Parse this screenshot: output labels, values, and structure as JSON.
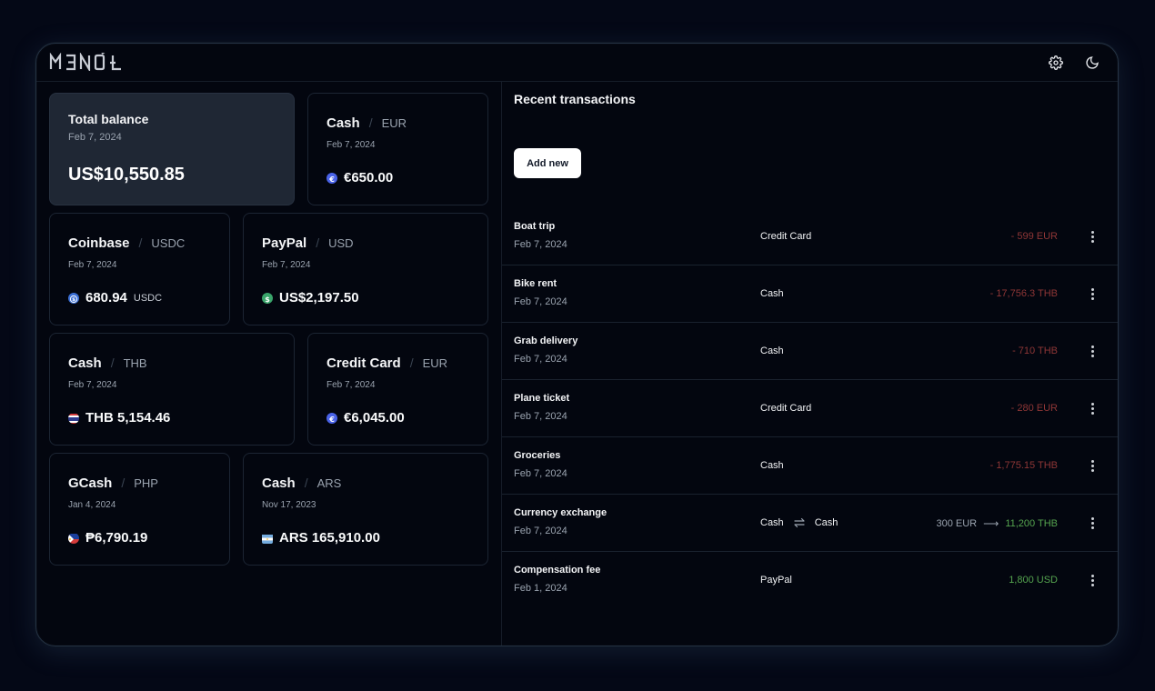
{
  "app": {
    "logo": "ᗰ ƎИ Ơ Ł"
  },
  "topbar": {
    "settings_icon": "gear-icon",
    "theme_icon": "moon-icon"
  },
  "total": {
    "title": "Total balance",
    "date": "Feb 7, 2024",
    "amount": "US$10,550.85"
  },
  "accounts": [
    {
      "name": "Cash",
      "currency": "EUR",
      "date": "Feb 7, 2024",
      "amount": "€650.00",
      "unit": "",
      "icon": "euro-coin-icon",
      "color": "#3f5fe0"
    },
    {
      "name": "Coinbase",
      "currency": "USDC",
      "date": "Feb 7, 2024",
      "amount": "680.94",
      "unit": "USDC",
      "icon": "usdc-coin-icon",
      "color": "#3b6fd4"
    },
    {
      "name": "PayPal",
      "currency": "USD",
      "date": "Feb 7, 2024",
      "amount": "US$2,197.50",
      "unit": "",
      "icon": "dollar-coin-icon",
      "color": "#3aa56b"
    },
    {
      "name": "Cash",
      "currency": "THB",
      "date": "Feb 7, 2024",
      "amount": "THB 5,154.46",
      "unit": "",
      "icon": "thailand-flag-icon",
      "color": "#2d3a8c"
    },
    {
      "name": "Credit Card",
      "currency": "EUR",
      "date": "Feb 7, 2024",
      "amount": "€6,045.00",
      "unit": "",
      "icon": "euro-coin-icon",
      "color": "#3f5fe0"
    },
    {
      "name": "GCash",
      "currency": "PHP",
      "date": "Jan 4, 2024",
      "amount": "₱6,790.19",
      "unit": "",
      "icon": "philippines-flag-icon",
      "color": "#1b3f9c"
    },
    {
      "name": "Cash",
      "currency": "ARS",
      "date": "Nov 17, 2023",
      "amount": "ARS 165,910.00",
      "unit": "",
      "icon": "argentina-flag-icon",
      "color": "#74acdf"
    }
  ],
  "transactions_panel": {
    "title": "Recent transactions",
    "add_button": "Add new"
  },
  "transactions": [
    {
      "name": "Boat trip",
      "date": "Feb 7, 2024",
      "account": "Credit Card",
      "amount": "- 599 EUR",
      "kind": "neg"
    },
    {
      "name": "Bike rent",
      "date": "Feb 7, 2024",
      "account": "Cash",
      "amount": "- 17,756.3 THB",
      "kind": "neg"
    },
    {
      "name": "Grab delivery",
      "date": "Feb 7, 2024",
      "account": "Cash",
      "amount": "- 710 THB",
      "kind": "neg"
    },
    {
      "name": "Plane ticket",
      "date": "Feb 7, 2024",
      "account": "Credit Card",
      "amount": "- 280 EUR",
      "kind": "neg"
    },
    {
      "name": "Groceries",
      "date": "Feb 7, 2024",
      "account": "Cash",
      "amount": "- 1,775.15 THB",
      "kind": "neg"
    },
    {
      "name": "Currency exchange",
      "date": "Feb 7, 2024",
      "account": "Cash",
      "account_to": "Cash",
      "amount_from": "300 EUR",
      "amount": "11,200 THB",
      "kind": "exchange"
    },
    {
      "name": "Compensation fee",
      "date": "Feb 1, 2024",
      "account": "PayPal",
      "amount": "1,800 USD",
      "kind": "pos"
    }
  ],
  "colors": {
    "negative": "#8e3636",
    "positive": "#55a44f",
    "background": "#03060f"
  }
}
